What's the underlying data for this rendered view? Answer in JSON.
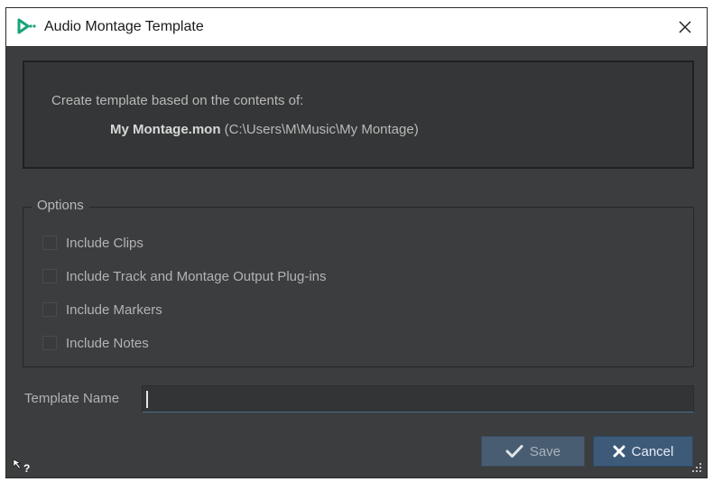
{
  "window": {
    "title": "Audio Montage Template",
    "app_icon": "wavelab-logo-icon",
    "close_icon": "close-icon"
  },
  "info": {
    "line1": "Create template based on the contents of:",
    "filename": "My Montage.mon",
    "path": " (C:\\Users\\M\\Music\\My Montage)"
  },
  "options": {
    "legend": "Options",
    "items": [
      {
        "label": "Include Clips",
        "checked": false
      },
      {
        "label": "Include Track and Montage Output Plug-ins",
        "checked": false
      },
      {
        "label": "Include Markers",
        "checked": false
      },
      {
        "label": "Include Notes",
        "checked": false
      }
    ]
  },
  "template_name": {
    "label": "Template Name",
    "value": ""
  },
  "buttons": {
    "save_label": "Save",
    "cancel_label": "Cancel"
  },
  "icons": {
    "save": "checkmark-icon",
    "cancel": "x-icon",
    "help": "whats-this-help-icon",
    "grip": "resize-grip-icon"
  },
  "colors": {
    "window_bg": "#3c3d3f",
    "title_bg": "#ffffff",
    "accent_blue": "#3d5b79",
    "logo_green": "#1aa37a"
  }
}
